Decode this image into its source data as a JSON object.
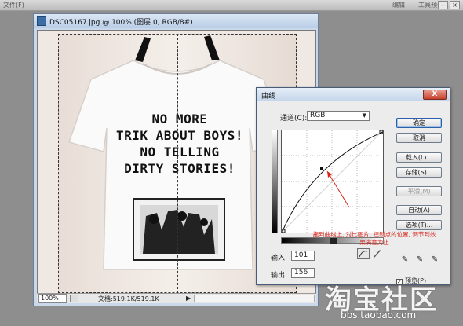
{
  "workspace": {
    "top_left_text": "文件(F)",
    "top_right_text_1": "编辑",
    "top_right_text_2": "工具预设"
  },
  "document": {
    "title": "DSC05167.jpg @ 100% (图层 0, RGB/8#)",
    "zoom": "100%",
    "doc_info": "文档:519.1K/519.1K",
    "shirt_print": [
      "NO MORE",
      "TRIK ABOUT BOYS!",
      "NO TELLING",
      "DIRTY STORIES!"
    ]
  },
  "curves_dialog": {
    "title": "曲线",
    "close_label": "X",
    "channel_label": "通道(C):",
    "channel_value": "RGB",
    "input_label": "输入:",
    "input_value": "101",
    "output_label": "输出:",
    "output_value": "156",
    "buttons": {
      "ok": "确定",
      "cancel": "取消",
      "load": "载入(L)...",
      "save": "存储(S)...",
      "smooth": "平滑(M)",
      "auto": "自动(A)",
      "options": "选项(T)..."
    },
    "preview_label": "预览(P)",
    "preview_checked": true,
    "annotation": "拖到曲线上, 对比图片, 控制点的位置, 调节到效果满意为止"
  },
  "watermark": {
    "logo": "淘宝社区",
    "url": "bbs.taobao.com"
  }
}
